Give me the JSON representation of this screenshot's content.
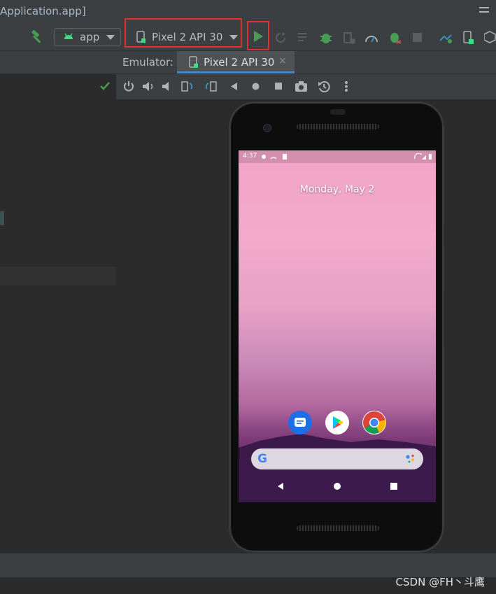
{
  "window": {
    "title": "Application.app]"
  },
  "toolbar": {
    "config_label": "app",
    "device_label": "Pixel 2 API 30",
    "highlight_color": "#e03030",
    "run_color": "#499c54"
  },
  "tabs": {
    "prefix": "Emulator:",
    "active_tab": "Pixel 2 API 30",
    "close_glyph": "×"
  },
  "emulator_controls": [
    "power-icon",
    "volume-up-icon",
    "volume-down-icon",
    "rotate-left-icon",
    "rotate-right-icon",
    "back-icon",
    "home-icon",
    "overview-icon",
    "screenshot-icon",
    "snapshot-icon",
    "more-icon"
  ],
  "phone": {
    "status_time": "4:37",
    "date": "Monday, May 2",
    "dock_apps": [
      "messages-icon",
      "play-store-icon",
      "chrome-icon"
    ],
    "search_bar_letter": "G"
  },
  "footer": {
    "watermark": "CSDN @FH丶斗鹰"
  }
}
